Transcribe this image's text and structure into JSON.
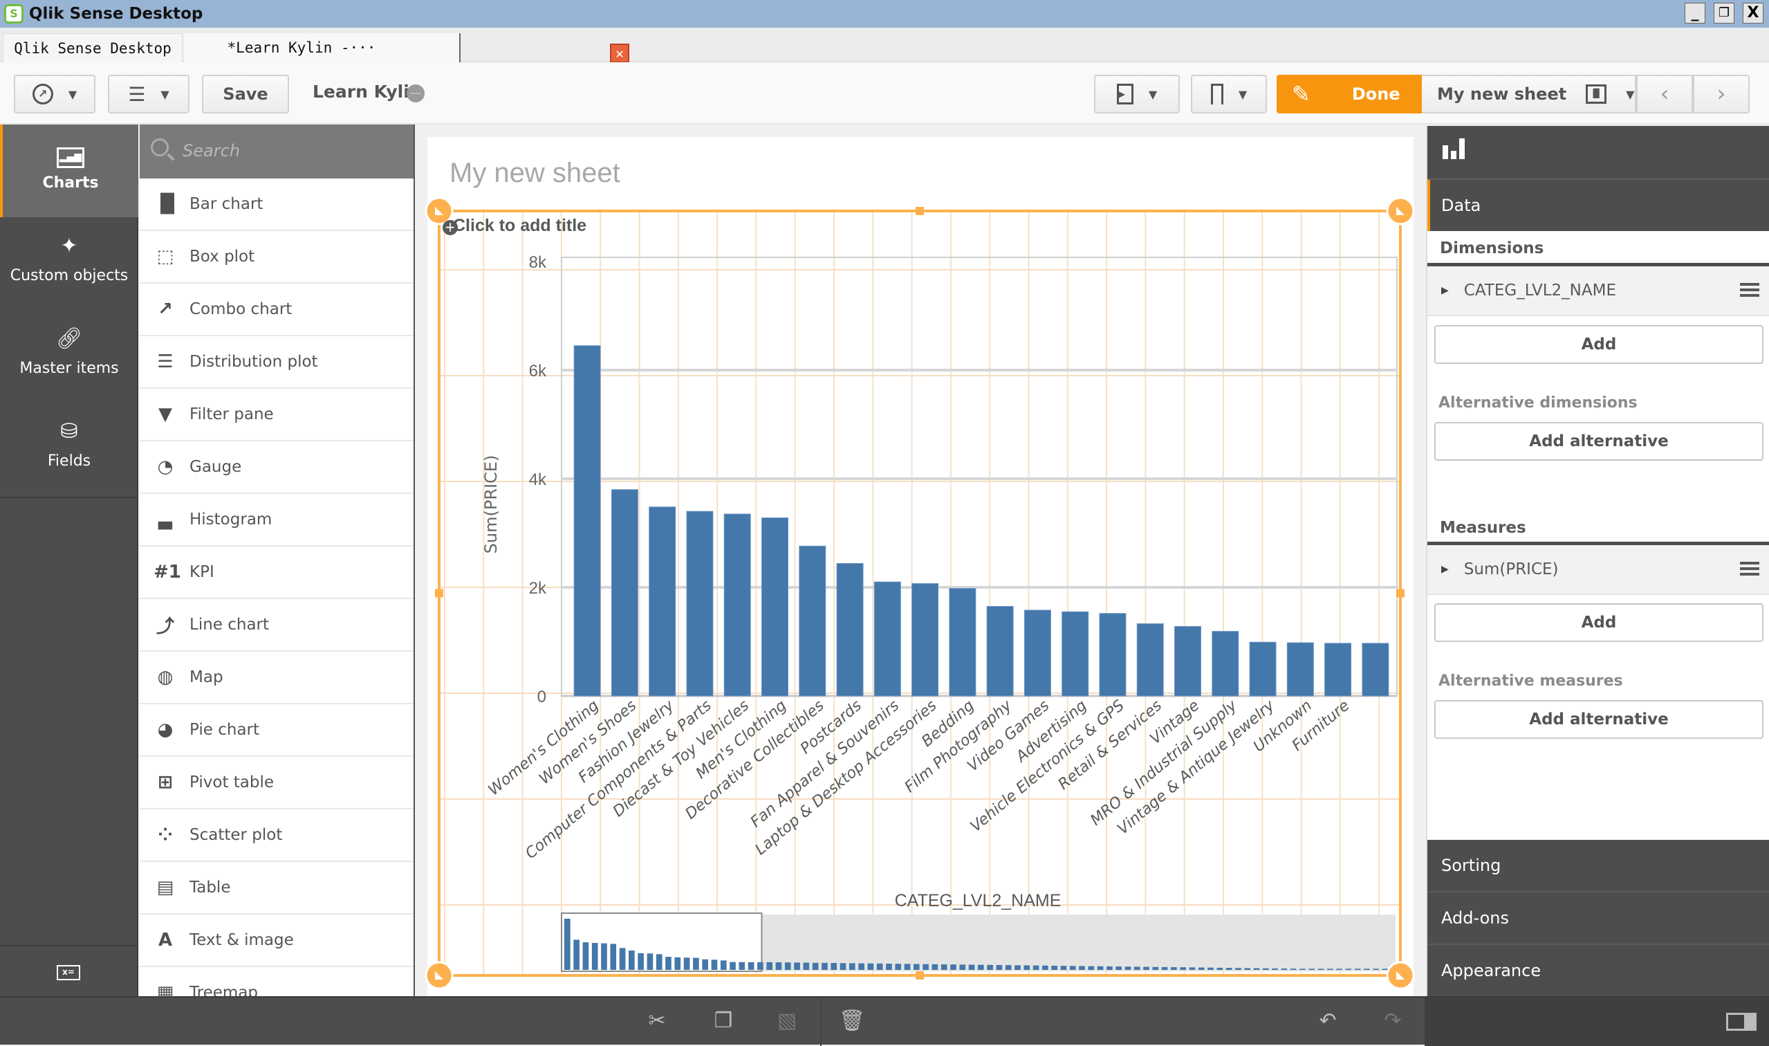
{
  "window": {
    "title": "Qlik Sense Desktop",
    "app_icon": "qlik-logo-icon",
    "controls": [
      "minimize",
      "restore",
      "close"
    ]
  },
  "tabs": [
    {
      "label": "Qlik Sense Desktop hub",
      "active": false
    },
    {
      "label": "*Learn Kylin -···",
      "active": true,
      "close_icon": "close-icon"
    }
  ],
  "toolbar": {
    "navigation_icon": "compass-icon",
    "global_menu_icon": "list-icon",
    "save_label": "Save",
    "app_name": "Learn Kylin",
    "storytelling_icon": "presentation-icon",
    "bookmark_icon": "bookmark-icon",
    "done_label": "Done",
    "edit_icon": "pencil-icon",
    "sheet_name": "My new sheet",
    "sheet_icon": "sheets-icon",
    "prev_label": "‹",
    "next_label": "›"
  },
  "left_nav": {
    "items": [
      {
        "label": "Charts",
        "icon": "bar-chart-icon",
        "active": true
      },
      {
        "label": "Custom objects",
        "icon": "puzzle-icon",
        "active": false
      },
      {
        "label": "Master items",
        "icon": "link-icon",
        "active": false
      },
      {
        "label": "Fields",
        "icon": "database-icon",
        "active": false
      }
    ],
    "variables_icon": "variables-icon"
  },
  "chart_list": {
    "search_placeholder": "Search",
    "items": [
      {
        "label": "Bar chart",
        "icon": "bar-chart-icon",
        "glyph": "▐▌"
      },
      {
        "label": "Box plot",
        "icon": "box-plot-icon",
        "glyph": "⬚"
      },
      {
        "label": "Combo chart",
        "icon": "combo-chart-icon",
        "glyph": "↗"
      },
      {
        "label": "Distribution plot",
        "icon": "distribution-plot-icon",
        "glyph": "☰"
      },
      {
        "label": "Filter pane",
        "icon": "filter-pane-icon",
        "glyph": "▼"
      },
      {
        "label": "Gauge",
        "icon": "gauge-icon",
        "glyph": "◔"
      },
      {
        "label": "Histogram",
        "icon": "histogram-icon",
        "glyph": "▃"
      },
      {
        "label": "KPI",
        "icon": "kpi-icon",
        "glyph": "#1"
      },
      {
        "label": "Line chart",
        "icon": "line-chart-icon",
        "glyph": "⤴"
      },
      {
        "label": "Map",
        "icon": "map-icon",
        "glyph": "◍"
      },
      {
        "label": "Pie chart",
        "icon": "pie-chart-icon",
        "glyph": "◕"
      },
      {
        "label": "Pivot table",
        "icon": "pivot-table-icon",
        "glyph": "⊞"
      },
      {
        "label": "Scatter plot",
        "icon": "scatter-plot-icon",
        "glyph": "⁘"
      },
      {
        "label": "Table",
        "icon": "table-icon",
        "glyph": "▤"
      },
      {
        "label": "Text & image",
        "icon": "text-image-icon",
        "glyph": "A"
      },
      {
        "label": "Treemap",
        "icon": "treemap-icon",
        "glyph": "▦"
      }
    ]
  },
  "sheet": {
    "title": "My new sheet",
    "add_title_label": "Click to add title"
  },
  "chart_data": {
    "type": "bar",
    "title": "",
    "xlabel": "CATEG_LVL2_NAME",
    "ylabel": "Sum(PRICE)",
    "ylim": [
      0,
      8000
    ],
    "yticks": [
      0,
      2000,
      4000,
      6000,
      8000
    ],
    "ytick_labels": [
      "0",
      "2k",
      "4k",
      "6k",
      "8k"
    ],
    "grid": true,
    "color": "#4477aa",
    "categories": [
      "Women's Clothing",
      "Women's Shoes",
      "Fashion Jewelry",
      "Computer Components & Parts",
      "Diecast & Toy Vehicles",
      "Men's Clothing",
      "Decorative Collectibles",
      "Postcards",
      "Fan Apparel & Souvenirs",
      "Laptop & Desktop Accessories",
      "Bedding",
      "Film Photography",
      "Video Games",
      "Advertising",
      "Vehicle Electronics & GPS",
      "Retail & Services",
      "Vintage",
      "MRO & Industrial Supply",
      "Vintage & Antique Jewelry",
      "Unknown",
      "Furniture"
    ],
    "values": [
      6450,
      3800,
      3480,
      3400,
      3350,
      3280,
      2760,
      2440,
      2100,
      2070,
      1980,
      1650,
      1580,
      1550,
      1520,
      1330,
      1280,
      1190,
      990,
      980,
      970,
      970
    ],
    "visible_window": {
      "start_fraction": 0.0,
      "end_fraction": 0.24
    },
    "scrollbar_minimap": true
  },
  "right_panel": {
    "header_icon": "bar-chart-icon",
    "data_tab": "Data",
    "dimensions_heading": "Dimensions",
    "dimension_field": "CATEG_LVL2_NAME",
    "add_label": "Add",
    "alt_dimensions_heading": "Alternative dimensions",
    "add_alternative_label": "Add alternative",
    "measures_heading": "Measures",
    "measure_field": "Sum(PRICE)",
    "alt_measures_heading": "Alternative measures",
    "sections": [
      "Sorting",
      "Add-ons",
      "Appearance"
    ]
  },
  "bottom_bar": {
    "icons": [
      "cut-icon",
      "copy-icon",
      "paste-icon",
      "delete-icon",
      "undo-icon",
      "redo-icon",
      "toggle-panel-icon"
    ]
  }
}
